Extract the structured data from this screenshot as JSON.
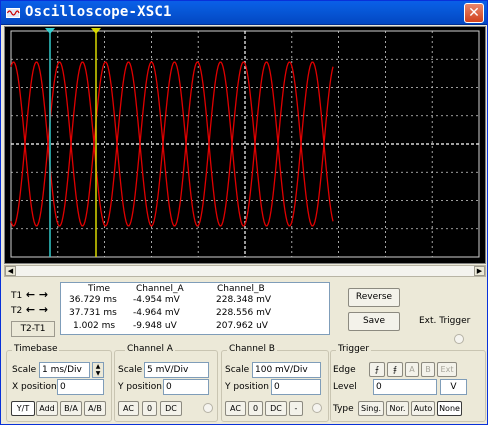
{
  "window": {
    "title": "Oscilloscope-XSC1",
    "close_glyph": "✕"
  },
  "icons": {
    "app": "oscilloscope-icon",
    "close": "close-icon"
  },
  "colors": {
    "screen_bg": "#000000",
    "grid": "#cfcfcf",
    "trace_a": "#e00000",
    "trace_b": "#e00000",
    "cursor_1": "#33cccc",
    "cursor_2": "#d8d800"
  },
  "cursors": {
    "t1_label": "T1",
    "t2_label": "T2",
    "t2t1_label": "T2-T1",
    "left_arrow": "←",
    "right_arrow": "→",
    "t1_time_ms": 36.729,
    "t2_time_ms": 37.731
  },
  "readout": {
    "headers": {
      "time": "Time",
      "channel_a": "Channel_A",
      "channel_b": "Channel_B"
    },
    "rows": [
      {
        "time": "36.729 ms",
        "channel_a": "-4.954 mV",
        "channel_b": "228.348 mV"
      },
      {
        "time": "37.731 ms",
        "channel_a": "-4.964 mV",
        "channel_b": "228.556 mV"
      },
      {
        "time": "1.002 ms",
        "channel_a": "-9.948 uV",
        "channel_b": "207.962 uV"
      }
    ]
  },
  "actions": {
    "reverse": "Reverse",
    "save": "Save",
    "ext_trigger": "Ext. Trigger"
  },
  "timebase": {
    "title": "Timebase",
    "scale_label": "Scale",
    "scale_value": "1 ms/Div",
    "xpos_label": "X position",
    "xpos_value": "0",
    "modes": [
      "Y/T",
      "Add",
      "B/A",
      "A/B"
    ],
    "active_mode": "Y/T"
  },
  "channel_a": {
    "title": "Channel A",
    "scale_label": "Scale",
    "scale_value": "5 mV/Div",
    "ypos_label": "Y position",
    "ypos_value": "0",
    "coupling": [
      "AC",
      "0",
      "DC"
    ]
  },
  "channel_b": {
    "title": "Channel B",
    "scale_label": "Scale",
    "scale_value": "100 mV/Div",
    "ypos_label": "Y position",
    "ypos_value": "0",
    "coupling": [
      "AC",
      "0",
      "DC",
      "-"
    ]
  },
  "trigger": {
    "title": "Trigger",
    "edge_label": "Edge",
    "edge_buttons": [
      "⨍",
      "⨎",
      "A",
      "B",
      "Ext"
    ],
    "level_label": "Level",
    "level_value": "0",
    "level_unit": "V",
    "type_label": "Type",
    "types": [
      "Sing.",
      "Nor.",
      "Auto",
      "None"
    ],
    "active_type": "None"
  }
}
